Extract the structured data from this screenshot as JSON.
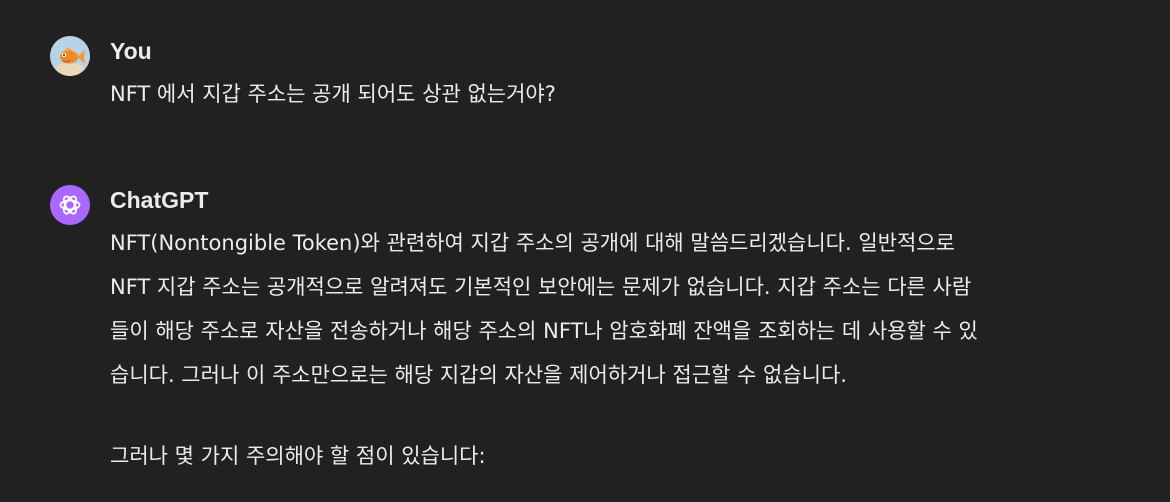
{
  "user_message": {
    "author": "You",
    "text": "NFT 에서 지갑 주소는 공개 되어도 상관 없는거야?"
  },
  "assistant_message": {
    "author": "ChatGPT",
    "paragraph1": [
      "NFT(Nontongible Token)와 관련하여 지갑 주소의 공개에 대해 말씀드리겠습니다. 일반적으로",
      "NFT 지갑 주소는 공개적으로 알려져도 기본적인 보안에는 문제가 없습니다. 지갑 주소는 다른 사람",
      "들이 해당 주소로 자산을 전송하거나 해당 주소의 NFT나 암호화폐 잔액을 조회하는 데 사용할 수 있",
      "습니다. 그러나 이 주소만으로는 해당 지갑의 자산을 제어하거나 접근할 수 없습니다."
    ],
    "paragraph2": "그러나 몇 가지 주의해야 할 점이 있습니다:"
  },
  "colors": {
    "background": "#212121",
    "text": "#ececec",
    "chatgpt_avatar": "#ab68ff"
  },
  "icons": {
    "user_avatar": "goldfish-avatar-icon",
    "assistant_avatar": "openai-logo-icon"
  }
}
